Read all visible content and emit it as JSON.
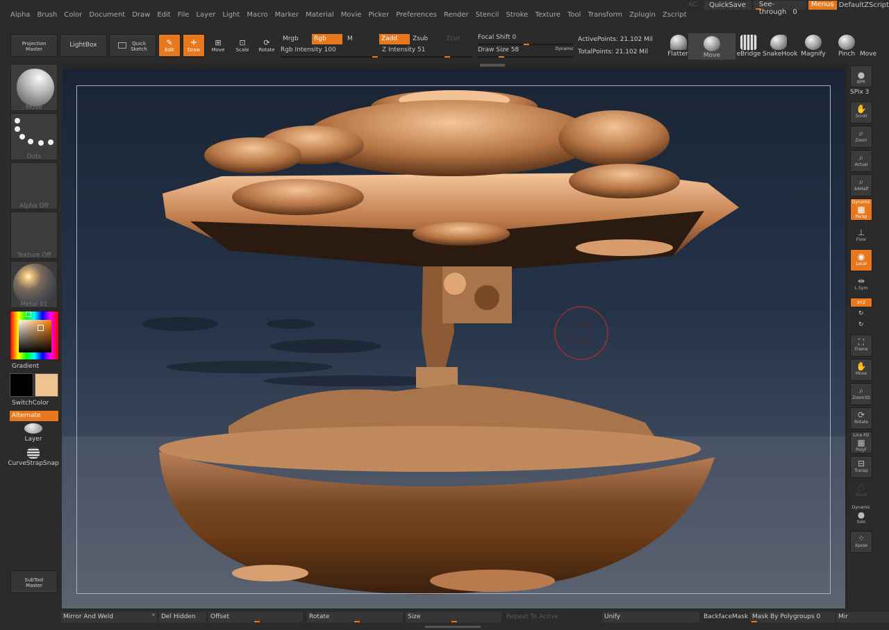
{
  "menubar": {
    "items": [
      "Alpha",
      "Brush",
      "Color",
      "Document",
      "Draw",
      "Edit",
      "File",
      "Layer",
      "Light",
      "Macro",
      "Marker",
      "Material",
      "Movie",
      "Picker",
      "Preferences",
      "Render",
      "Stencil",
      "Stroke",
      "Texture",
      "Tool",
      "Transform",
      "Zplugin",
      "Zscript"
    ],
    "ac": "AC",
    "quicksave": "QuickSave",
    "see_through": "See-through",
    "see_through_value": "0",
    "menus": "Menus",
    "script": "DefaultZScript"
  },
  "toolbar": {
    "projection_master": "Projection\nMaster",
    "lightbox": "LightBox",
    "quick_sketch": "Quick\nSketch",
    "edit": "Edit",
    "draw": "Draw",
    "move": "Move",
    "scale": "Scale",
    "rotate": "Rotate",
    "mrgb": "Mrgb",
    "rgb": "Rgb",
    "m": "M",
    "zadd": "Zadd",
    "zsub": "Zsub",
    "zcut": "Zcut",
    "rgb_intensity": "Rgb Intensity 100",
    "z_intensity": "Z Intensity 51",
    "focal_shift": "Focal Shift 0",
    "draw_size": "Draw Size 58",
    "dynamic": "Dynamic",
    "active_points": "ActivePoints: 21.102 Mil",
    "total_points": "TotalPoints: 21.102 Mil",
    "brushes": [
      "Flatten",
      "Move",
      "eBridge",
      "SnakeHook",
      "Magnify",
      "Pinch",
      "Move"
    ]
  },
  "left": {
    "brush": "Move",
    "stroke": "Dots",
    "alpha": "Alpha Off",
    "texture": "Texture Off",
    "material": "Metal 01",
    "gradient": "Gradient",
    "switch_color": "SwitchColor",
    "alternate": "Alternate",
    "layer": "Layer",
    "curve_strap": "CurveStrapSnap",
    "subtool_master": "SubTool\nMaster"
  },
  "right": {
    "spix": "SPix 3",
    "buttons": [
      "BPR",
      "Scroll",
      "Zoom",
      "Actual",
      "AAHalf",
      "Persp",
      "Floor",
      "Local",
      "L.Sym",
      "XYZ",
      "Frame",
      "Move",
      "Zoom3D",
      "Rotate",
      "PolyF",
      "Transp",
      "Ghost",
      "Solo",
      "Xpose"
    ],
    "dynamic": "Dynamic",
    "line_fill": "Line Fill"
  },
  "bottom": {
    "mirror_weld": "Mirror And Weld",
    "del_hidden": "Del Hidden",
    "offset": "Offset",
    "rotate": "Rotate",
    "size": "Size",
    "repeat": "Repeat To Active",
    "unify": "Unify",
    "backface": "BackfaceMask",
    "mask_polygroups": "Mask By Polygroups 0",
    "mir": "Mir"
  },
  "colors": {
    "accent": "#e8781d",
    "primary_color": "#000000",
    "secondary_color": "#f0c290"
  }
}
